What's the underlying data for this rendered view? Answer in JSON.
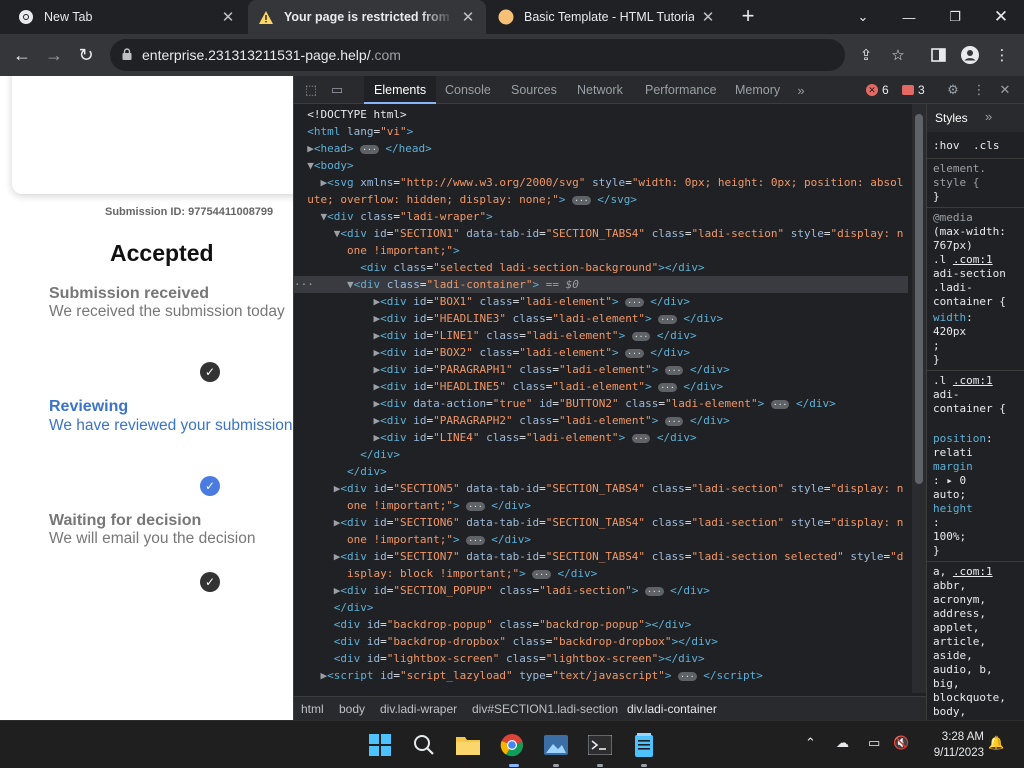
{
  "browser": {
    "tabs": [
      {
        "title": "New Tab",
        "icon": "chrome-icon"
      },
      {
        "title": "Your page is restricted from ac",
        "icon": "warning-icon"
      },
      {
        "title": "Basic Template - HTML Tutorial",
        "icon": "site-icon"
      }
    ],
    "url_host": "enterprise.231313211531-page.help/",
    "url_path": ".com"
  },
  "page": {
    "submission_id": "Submission ID: 97754411008799",
    "status_heading": "Accepted",
    "steps": [
      {
        "title": "Submission received",
        "desc": "We received the submission today",
        "title_color": "#777777",
        "desc_color": "#777777"
      },
      {
        "title": "Reviewing",
        "desc": "We have reviewed your submission",
        "title_color": "#3b73c8",
        "desc_color": "#3b73c8"
      },
      {
        "title": "Waiting for decision",
        "desc": "We will email you the decision",
        "title_color": "#777777",
        "desc_color": "#777777"
      }
    ]
  },
  "devtools": {
    "tabs": [
      "Elements",
      "Console",
      "Sources",
      "Network",
      "Performance",
      "Memory"
    ],
    "errors": "6",
    "issues": "3",
    "styles_tab": "Styles",
    "hov": ":hov",
    "cls": ".cls",
    "breadcrumbs": [
      "html",
      "body",
      "div.ladi-wraper",
      "div#SECTION1.ladi-section",
      "div.ladi-container"
    ]
  },
  "taskbar": {
    "time": "3:28 AM",
    "date": "9/11/2023"
  }
}
